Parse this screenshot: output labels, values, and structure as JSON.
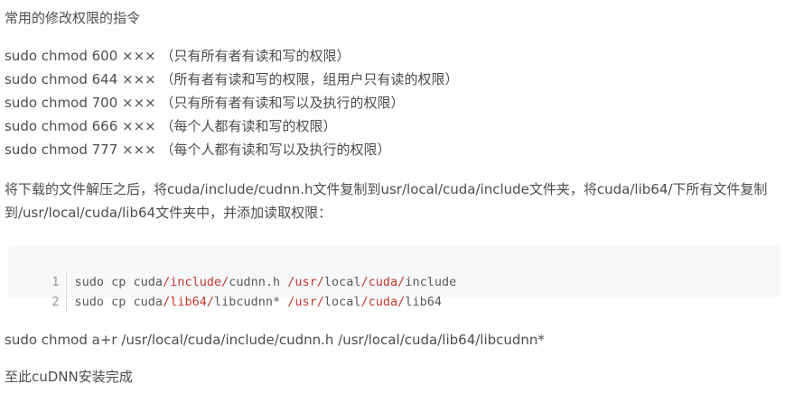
{
  "heading": "常用的修改权限的指令",
  "permissions": [
    "sudo chmod 600 ××× （只有所有者有读和写的权限）",
    "sudo chmod 644 ××× （所有者有读和写的权限，组用户只有读的权限）",
    "sudo chmod 700 ××× （只有所有者有读和写以及执行的权限）",
    "sudo chmod 666 ××× （每个人都有读和写的权限）",
    "sudo chmod 777 ××× （每个人都有读和写以及执行的权限）"
  ],
  "paragraph": "将下载的文件解压之后，将cuda/include/cudnn.h文件复制到usr/local/cuda/include文件夹，将cuda/lib64/下所有文件复制到/usr/local/cuda/lib64文件夹中，并添加读取权限：",
  "code": {
    "lines": [
      {
        "number": "1",
        "tokens": [
          {
            "text": "sudo cp cuda",
            "style": "plain"
          },
          {
            "text": "/include/",
            "style": "red"
          },
          {
            "text": "cudnn.h ",
            "style": "plain"
          },
          {
            "text": "/usr/",
            "style": "red"
          },
          {
            "text": "local",
            "style": "plain"
          },
          {
            "text": "/cuda/",
            "style": "red"
          },
          {
            "text": "include",
            "style": "plain"
          }
        ]
      },
      {
        "number": "2",
        "tokens": [
          {
            "text": "sudo cp cuda",
            "style": "plain"
          },
          {
            "text": "/lib64/",
            "style": "red"
          },
          {
            "text": "libcudnn* ",
            "style": "plain"
          },
          {
            "text": "/usr/",
            "style": "red"
          },
          {
            "text": "local",
            "style": "plain"
          },
          {
            "text": "/cuda/",
            "style": "red"
          },
          {
            "text": "lib64",
            "style": "plain"
          }
        ]
      }
    ]
  },
  "command": "sudo chmod a+r /usr/local/cuda/include/cudnn.h /usr/local/cuda/lib64/libcudnn*",
  "conclusion": "至此cuDNN安装完成",
  "colors": {
    "text": "#4d4d4d",
    "code_background": "#f6f8fa",
    "code_keyword_red": "#c0392b",
    "line_number": "#999999"
  }
}
